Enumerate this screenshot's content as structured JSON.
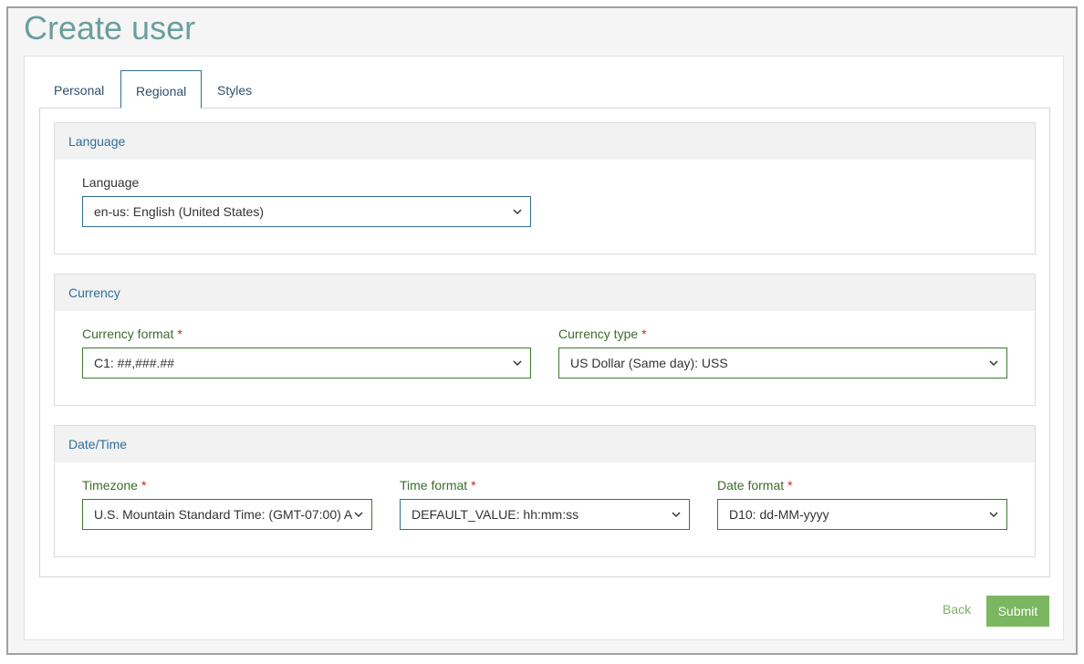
{
  "page": {
    "title": "Create user"
  },
  "tabs": [
    {
      "label": "Personal",
      "active": false
    },
    {
      "label": "Regional",
      "active": true
    },
    {
      "label": "Styles",
      "active": false
    }
  ],
  "sections": {
    "language": {
      "header": "Language",
      "fields": {
        "language": {
          "label": "Language",
          "required": false,
          "value": "en-us: English (United States)"
        }
      }
    },
    "currency": {
      "header": "Currency",
      "fields": {
        "currency_format": {
          "label": "Currency format",
          "required": true,
          "value": "C1: ##,###.##"
        },
        "currency_type": {
          "label": "Currency type",
          "required": true,
          "value": "US Dollar (Same day): USS"
        }
      }
    },
    "datetime": {
      "header": "Date/Time",
      "fields": {
        "timezone": {
          "label": "Timezone",
          "required": true,
          "value": "U.S. Mountain Standard Time: (GMT-07:00) A"
        },
        "time_format": {
          "label": "Time format",
          "required": true,
          "value": "DEFAULT_VALUE: hh:mm:ss"
        },
        "date_format": {
          "label": "Date format",
          "required": true,
          "value": "D10: dd-MM-yyyy"
        }
      }
    }
  },
  "actions": {
    "back_label": "Back",
    "submit_label": "Submit"
  },
  "required_marker": "*",
  "icons": {
    "select_arrow": "chevron-down-icon"
  },
  "colors": {
    "title": "#6b9e9e",
    "section_header_text": "#2f6f9a",
    "required_label": "#3d6b2f",
    "required_star": "#cc2222",
    "submit_bg": "#7bb661",
    "back_link": "#7bb06a"
  }
}
